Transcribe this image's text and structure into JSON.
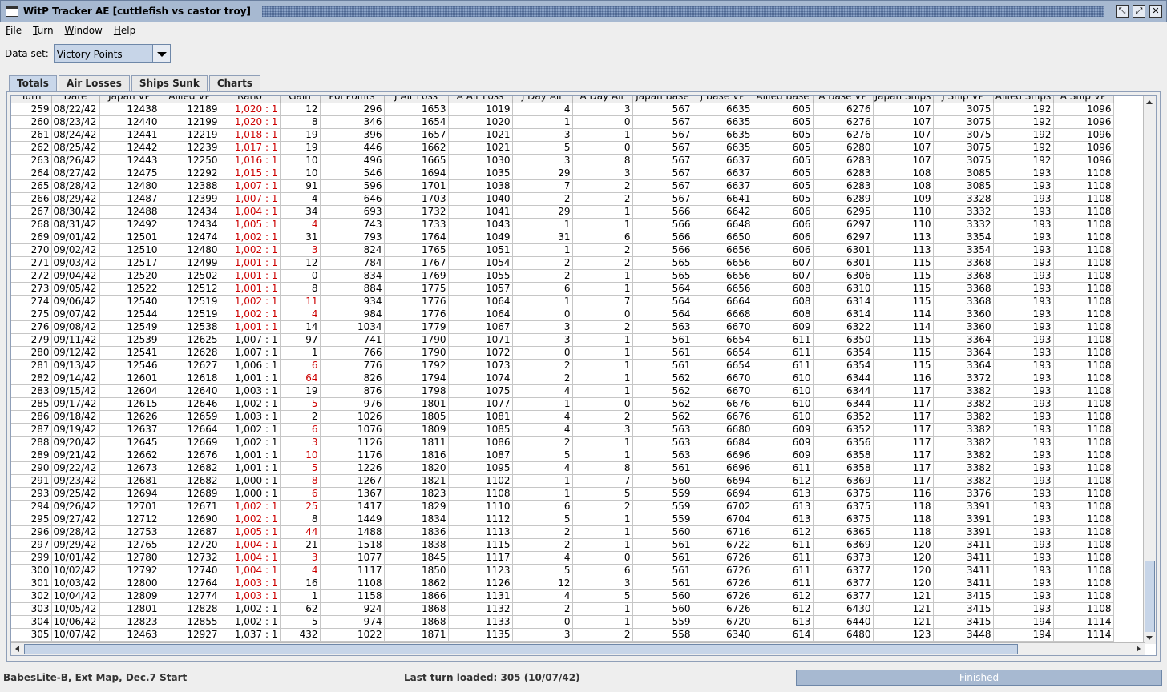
{
  "window": {
    "title": "WitP Tracker AE [cuttlefish vs castor troy]"
  },
  "menu": [
    "File",
    "Turn",
    "Window",
    "Help"
  ],
  "dataset": {
    "label": "Data set:",
    "value": "Victory Points"
  },
  "tabs": [
    "Totals",
    "Air Losses",
    "Ships Sunk",
    "Charts"
  ],
  "table": {
    "columns": [
      "Turn",
      "Date",
      "Japan VP",
      "Allied VP",
      "Ratio",
      "Gain",
      "Pol Points",
      "J Air Loss",
      "A Air Loss",
      "J Day Air",
      "A Day Air",
      "Japan Base",
      "J Base VP",
      "Allied Base",
      "A Base VP",
      "Japan Ships",
      "J Ship VP",
      "Allied Ships",
      "A Ship VP"
    ],
    "rows": [
      [
        "259",
        "08/22/42",
        "12438",
        "12189",
        "1,020 : 1",
        "12",
        "296",
        "1653",
        "1019",
        "4",
        "3",
        "567",
        "6635",
        "605",
        "6276",
        "107",
        "3075",
        "192",
        "1096"
      ],
      [
        "260",
        "08/23/42",
        "12440",
        "12199",
        "1,020 : 1",
        "8",
        "346",
        "1654",
        "1020",
        "1",
        "0",
        "567",
        "6635",
        "605",
        "6276",
        "107",
        "3075",
        "192",
        "1096"
      ],
      [
        "261",
        "08/24/42",
        "12441",
        "12219",
        "1,018 : 1",
        "19",
        "396",
        "1657",
        "1021",
        "3",
        "1",
        "567",
        "6635",
        "605",
        "6276",
        "107",
        "3075",
        "192",
        "1096"
      ],
      [
        "262",
        "08/25/42",
        "12442",
        "12239",
        "1,017 : 1",
        "19",
        "446",
        "1662",
        "1021",
        "5",
        "0",
        "567",
        "6635",
        "605",
        "6280",
        "107",
        "3075",
        "192",
        "1096"
      ],
      [
        "263",
        "08/26/42",
        "12443",
        "12250",
        "1,016 : 1",
        "10",
        "496",
        "1665",
        "1030",
        "3",
        "8",
        "567",
        "6637",
        "605",
        "6283",
        "107",
        "3075",
        "192",
        "1096"
      ],
      [
        "264",
        "08/27/42",
        "12475",
        "12292",
        "1,015 : 1",
        "10",
        "546",
        "1694",
        "1035",
        "29",
        "3",
        "567",
        "6637",
        "605",
        "6283",
        "108",
        "3085",
        "193",
        "1108"
      ],
      [
        "265",
        "08/28/42",
        "12480",
        "12388",
        "1,007 : 1",
        "91",
        "596",
        "1701",
        "1038",
        "7",
        "2",
        "567",
        "6637",
        "605",
        "6283",
        "108",
        "3085",
        "193",
        "1108"
      ],
      [
        "266",
        "08/29/42",
        "12487",
        "12399",
        "1,007 : 1",
        "4",
        "646",
        "1703",
        "1040",
        "2",
        "2",
        "567",
        "6641",
        "605",
        "6289",
        "109",
        "3328",
        "193",
        "1108"
      ],
      [
        "267",
        "08/30/42",
        "12488",
        "12434",
        "1,004 : 1",
        "34",
        "693",
        "1732",
        "1041",
        "29",
        "1",
        "566",
        "6642",
        "606",
        "6295",
        "110",
        "3332",
        "193",
        "1108"
      ],
      [
        "268",
        "08/31/42",
        "12492",
        "12434",
        "1,005 : 1",
        "4",
        "743",
        "1733",
        "1043",
        "1",
        "1",
        "566",
        "6648",
        "606",
        "6297",
        "110",
        "3332",
        "193",
        "1108"
      ],
      [
        "269",
        "09/01/42",
        "12501",
        "12474",
        "1,002 : 1",
        "31",
        "793",
        "1764",
        "1049",
        "31",
        "6",
        "566",
        "6650",
        "606",
        "6297",
        "113",
        "3354",
        "193",
        "1108"
      ],
      [
        "270",
        "09/02/42",
        "12510",
        "12480",
        "1,002 : 1",
        "3",
        "824",
        "1765",
        "1051",
        "1",
        "2",
        "566",
        "6656",
        "606",
        "6301",
        "113",
        "3354",
        "193",
        "1108"
      ],
      [
        "271",
        "09/03/42",
        "12517",
        "12499",
        "1,001 : 1",
        "12",
        "784",
        "1767",
        "1054",
        "2",
        "2",
        "565",
        "6656",
        "607",
        "6301",
        "115",
        "3368",
        "193",
        "1108"
      ],
      [
        "272",
        "09/04/42",
        "12520",
        "12502",
        "1,001 : 1",
        "0",
        "834",
        "1769",
        "1055",
        "2",
        "1",
        "565",
        "6656",
        "607",
        "6306",
        "115",
        "3368",
        "193",
        "1108"
      ],
      [
        "273",
        "09/05/42",
        "12522",
        "12512",
        "1,001 : 1",
        "8",
        "884",
        "1775",
        "1057",
        "6",
        "1",
        "564",
        "6656",
        "608",
        "6310",
        "115",
        "3368",
        "193",
        "1108"
      ],
      [
        "274",
        "09/06/42",
        "12540",
        "12519",
        "1,002 : 1",
        "11",
        "934",
        "1776",
        "1064",
        "1",
        "7",
        "564",
        "6664",
        "608",
        "6314",
        "115",
        "3368",
        "193",
        "1108"
      ],
      [
        "275",
        "09/07/42",
        "12544",
        "12519",
        "1,002 : 1",
        "4",
        "984",
        "1776",
        "1064",
        "0",
        "0",
        "564",
        "6668",
        "608",
        "6314",
        "114",
        "3360",
        "193",
        "1108"
      ],
      [
        "276",
        "09/08/42",
        "12549",
        "12538",
        "1,001 : 1",
        "14",
        "1034",
        "1779",
        "1067",
        "3",
        "2",
        "563",
        "6670",
        "609",
        "6322",
        "114",
        "3360",
        "193",
        "1108"
      ],
      [
        "279",
        "09/11/42",
        "12539",
        "12625",
        "1,007 : 1",
        "97",
        "741",
        "1790",
        "1071",
        "3",
        "1",
        "561",
        "6654",
        "611",
        "6350",
        "115",
        "3364",
        "193",
        "1108"
      ],
      [
        "280",
        "09/12/42",
        "12541",
        "12628",
        "1,007 : 1",
        "1",
        "766",
        "1790",
        "1072",
        "0",
        "1",
        "561",
        "6654",
        "611",
        "6354",
        "115",
        "3364",
        "193",
        "1108"
      ],
      [
        "281",
        "09/13/42",
        "12546",
        "12627",
        "1,006 : 1",
        "6",
        "776",
        "1792",
        "1073",
        "2",
        "1",
        "561",
        "6654",
        "611",
        "6354",
        "115",
        "3364",
        "193",
        "1108"
      ],
      [
        "282",
        "09/14/42",
        "12601",
        "12618",
        "1,001 : 1",
        "64",
        "826",
        "1794",
        "1074",
        "2",
        "1",
        "562",
        "6670",
        "610",
        "6344",
        "116",
        "3372",
        "193",
        "1108"
      ],
      [
        "283",
        "09/15/42",
        "12604",
        "12640",
        "1,003 : 1",
        "19",
        "876",
        "1798",
        "1075",
        "4",
        "1",
        "562",
        "6670",
        "610",
        "6344",
        "117",
        "3382",
        "193",
        "1108"
      ],
      [
        "285",
        "09/17/42",
        "12615",
        "12646",
        "1,002 : 1",
        "5",
        "976",
        "1801",
        "1077",
        "1",
        "0",
        "562",
        "6676",
        "610",
        "6344",
        "117",
        "3382",
        "193",
        "1108"
      ],
      [
        "286",
        "09/18/42",
        "12626",
        "12659",
        "1,003 : 1",
        "2",
        "1026",
        "1805",
        "1081",
        "4",
        "2",
        "562",
        "6676",
        "610",
        "6352",
        "117",
        "3382",
        "193",
        "1108"
      ],
      [
        "287",
        "09/19/42",
        "12637",
        "12664",
        "1,002 : 1",
        "6",
        "1076",
        "1809",
        "1085",
        "4",
        "3",
        "563",
        "6680",
        "609",
        "6352",
        "117",
        "3382",
        "193",
        "1108"
      ],
      [
        "288",
        "09/20/42",
        "12645",
        "12669",
        "1,002 : 1",
        "3",
        "1126",
        "1811",
        "1086",
        "2",
        "1",
        "563",
        "6684",
        "609",
        "6356",
        "117",
        "3382",
        "193",
        "1108"
      ],
      [
        "289",
        "09/21/42",
        "12662",
        "12676",
        "1,001 : 1",
        "10",
        "1176",
        "1816",
        "1087",
        "5",
        "1",
        "563",
        "6696",
        "609",
        "6358",
        "117",
        "3382",
        "193",
        "1108"
      ],
      [
        "290",
        "09/22/42",
        "12673",
        "12682",
        "1,001 : 1",
        "5",
        "1226",
        "1820",
        "1095",
        "4",
        "8",
        "561",
        "6696",
        "611",
        "6358",
        "117",
        "3382",
        "193",
        "1108"
      ],
      [
        "291",
        "09/23/42",
        "12681",
        "12682",
        "1,000 : 1",
        "8",
        "1267",
        "1821",
        "1102",
        "1",
        "7",
        "560",
        "6694",
        "612",
        "6369",
        "117",
        "3382",
        "193",
        "1108"
      ],
      [
        "293",
        "09/25/42",
        "12694",
        "12689",
        "1,000 : 1",
        "6",
        "1367",
        "1823",
        "1108",
        "1",
        "5",
        "559",
        "6694",
        "613",
        "6375",
        "116",
        "3376",
        "193",
        "1108"
      ],
      [
        "294",
        "09/26/42",
        "12701",
        "12671",
        "1,002 : 1",
        "25",
        "1417",
        "1829",
        "1110",
        "6",
        "2",
        "559",
        "6702",
        "613",
        "6375",
        "118",
        "3391",
        "193",
        "1108"
      ],
      [
        "295",
        "09/27/42",
        "12712",
        "12690",
        "1,002 : 1",
        "8",
        "1449",
        "1834",
        "1112",
        "5",
        "1",
        "559",
        "6704",
        "613",
        "6375",
        "118",
        "3391",
        "193",
        "1108"
      ],
      [
        "296",
        "09/28/42",
        "12753",
        "12687",
        "1,005 : 1",
        "44",
        "1488",
        "1836",
        "1113",
        "2",
        "1",
        "560",
        "6716",
        "612",
        "6365",
        "118",
        "3391",
        "193",
        "1108"
      ],
      [
        "297",
        "09/29/42",
        "12765",
        "12720",
        "1,004 : 1",
        "21",
        "1518",
        "1838",
        "1115",
        "2",
        "1",
        "561",
        "6722",
        "611",
        "6369",
        "120",
        "3411",
        "193",
        "1108"
      ],
      [
        "299",
        "10/01/42",
        "12780",
        "12732",
        "1,004 : 1",
        "3",
        "1077",
        "1845",
        "1117",
        "4",
        "0",
        "561",
        "6726",
        "611",
        "6373",
        "120",
        "3411",
        "193",
        "1108"
      ],
      [
        "300",
        "10/02/42",
        "12792",
        "12740",
        "1,004 : 1",
        "4",
        "1117",
        "1850",
        "1123",
        "5",
        "6",
        "561",
        "6726",
        "611",
        "6377",
        "120",
        "3411",
        "193",
        "1108"
      ],
      [
        "301",
        "10/03/42",
        "12800",
        "12764",
        "1,003 : 1",
        "16",
        "1108",
        "1862",
        "1126",
        "12",
        "3",
        "561",
        "6726",
        "611",
        "6377",
        "120",
        "3411",
        "193",
        "1108"
      ],
      [
        "302",
        "10/04/42",
        "12809",
        "12774",
        "1,003 : 1",
        "1",
        "1158",
        "1866",
        "1131",
        "4",
        "5",
        "560",
        "6726",
        "612",
        "6377",
        "121",
        "3415",
        "193",
        "1108"
      ],
      [
        "303",
        "10/05/42",
        "12801",
        "12828",
        "1,002 : 1",
        "62",
        "924",
        "1868",
        "1132",
        "2",
        "1",
        "560",
        "6726",
        "612",
        "6430",
        "121",
        "3415",
        "193",
        "1108"
      ],
      [
        "304",
        "10/06/42",
        "12823",
        "12855",
        "1,002 : 1",
        "5",
        "974",
        "1868",
        "1133",
        "0",
        "1",
        "559",
        "6720",
        "613",
        "6440",
        "121",
        "3415",
        "194",
        "1114"
      ],
      [
        "305",
        "10/07/42",
        "12463",
        "12927",
        "1,037 : 1",
        "432",
        "1022",
        "1871",
        "1135",
        "3",
        "2",
        "558",
        "6340",
        "614",
        "6480",
        "123",
        "3448",
        "194",
        "1114"
      ]
    ],
    "red_ratio_rows": [
      0,
      1,
      2,
      3,
      4,
      5,
      6,
      7,
      8,
      9,
      10,
      11,
      12,
      13,
      14,
      15,
      16,
      17,
      31,
      32,
      33,
      34,
      35,
      36,
      37,
      38
    ],
    "red_gain_rows": [
      9,
      11,
      15,
      16,
      20,
      21,
      23,
      25,
      26,
      27,
      28,
      29,
      30,
      31,
      33,
      35,
      36
    ]
  },
  "status": {
    "left": "BabesLite-B, Ext Map, Dec.7 Start",
    "middle": "Last turn loaded: 305 (10/07/42)",
    "progress": "Finished"
  },
  "colors": {
    "title_bar": "#a7b9d1",
    "selected_tab": "#c9d7ea",
    "red_text": "#cc0000"
  }
}
